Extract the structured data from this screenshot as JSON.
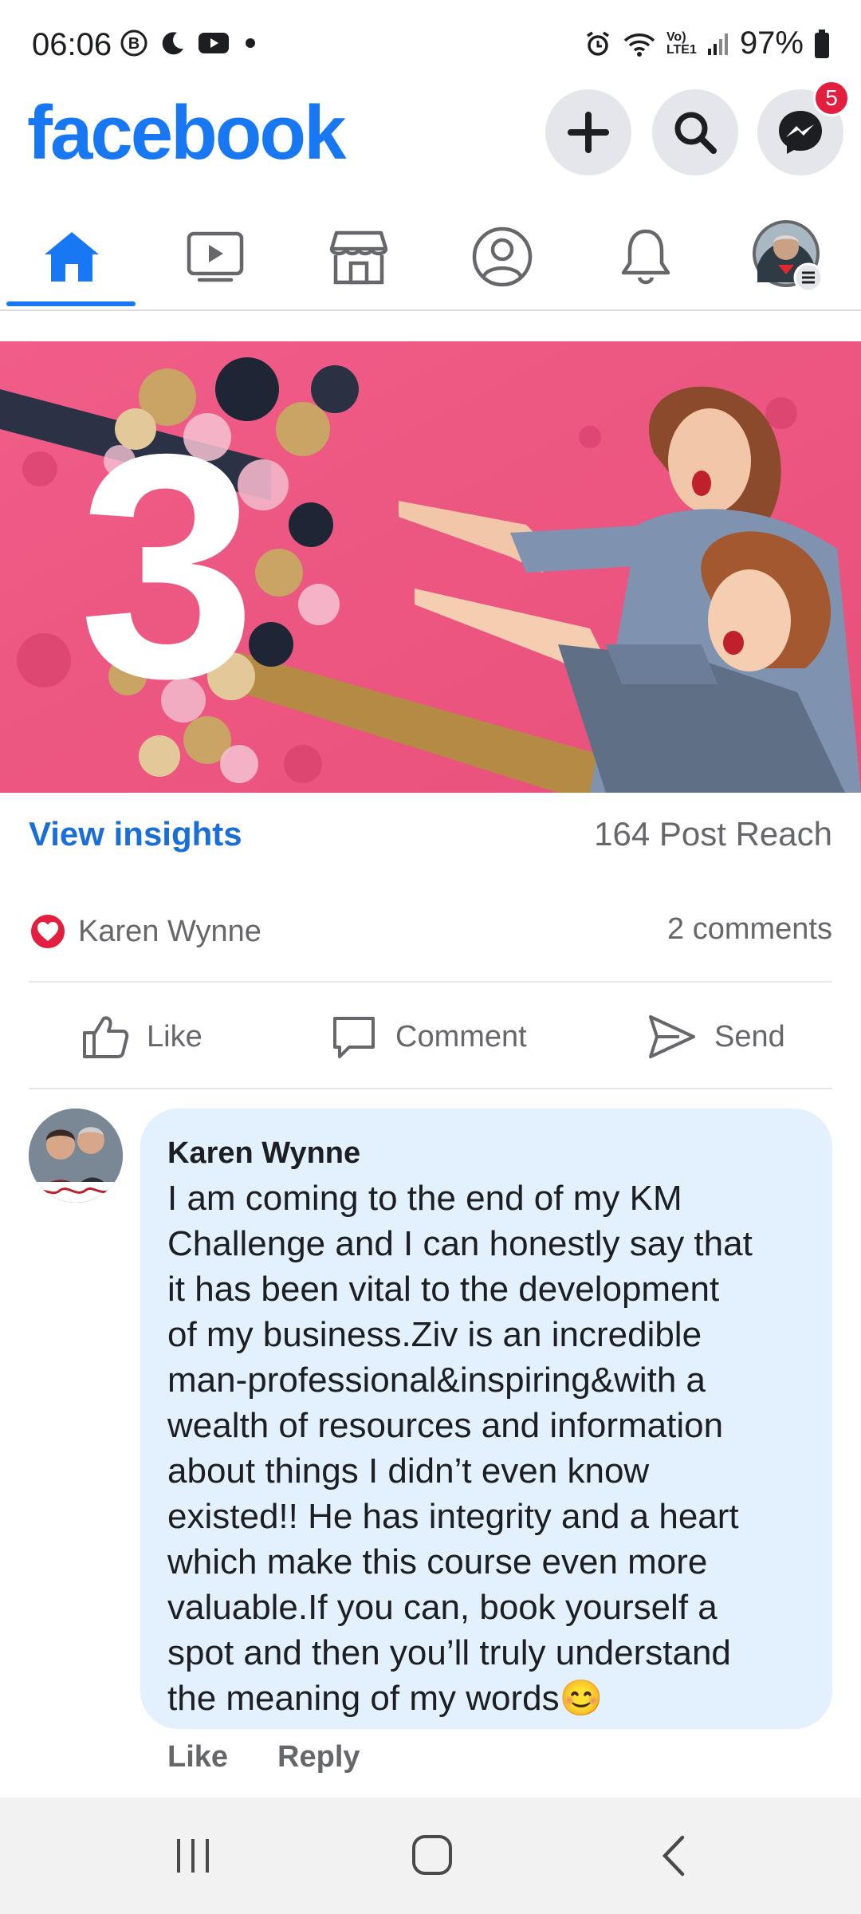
{
  "status_bar": {
    "time": "06:06",
    "battery": "97%",
    "network_label": "Vo) LTE1",
    "icons": [
      "b-circle-icon",
      "moon-icon",
      "youtube-icon",
      "dot-icon",
      "alarm-icon",
      "wifi-icon",
      "signal-icon",
      "battery-icon"
    ]
  },
  "header": {
    "logo": "facebook",
    "messenger_badge": "5",
    "icons": [
      "plus-icon",
      "search-icon",
      "messenger-icon"
    ]
  },
  "tabs": [
    {
      "name": "home",
      "icon": "home-icon",
      "active": true
    },
    {
      "name": "watch",
      "icon": "video-icon",
      "active": false
    },
    {
      "name": "marketplace",
      "icon": "store-icon",
      "active": false
    },
    {
      "name": "profile",
      "icon": "profile-icon",
      "active": false
    },
    {
      "name": "notifications",
      "icon": "bell-icon",
      "active": false
    },
    {
      "name": "menu",
      "icon": "menu-avatar-icon",
      "active": false
    }
  ],
  "post": {
    "image_number": "3",
    "insights_label": "View insights",
    "reach": "164 Post Reach",
    "reactor": "Karen Wynne",
    "comments_count": "2 comments",
    "actions": {
      "like": "Like",
      "comment": "Comment",
      "send": "Send"
    }
  },
  "comment": {
    "author": "Karen Wynne",
    "text": "I am coming to the end of my KM\nChallenge and I can honestly say that\nit has been vital to the development\nof my business.Ziv is an incredible\nman-professional&inspiring&with a\nwealth of resources and information\nabout things I didn’t even know\nexisted!! He has integrity and a heart\nwhich make this course even more\nvaluable.If you can, book yourself a\nspot and then you’ll truly understand\nthe meaning of my words😊",
    "like_label": "Like",
    "reply_label": "Reply"
  },
  "colors": {
    "brand": "#1877f2",
    "love": "#e41e3f",
    "bubble": "#e3f0fd",
    "image_bg": "#ee5b86"
  }
}
